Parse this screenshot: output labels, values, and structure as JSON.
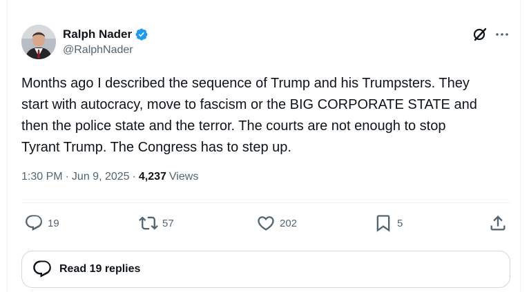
{
  "author": {
    "display_name": "Ralph Nader",
    "handle": "@RalphNader",
    "verified_badge_color": "#1d9bf0"
  },
  "tweet": {
    "text": "Months ago I described the sequence of Trump and his Trumpsters. They\nstart with autocracy, move to fascism or the BIG CORPORATE STATE and\nthen the police state and the terror. The courts are not enough to stop\nTyrant Trump. The Congress has to step up."
  },
  "meta": {
    "time": "1:30 PM",
    "separator": "·",
    "date": "Jun 9, 2025",
    "views_count": "4,237",
    "views_label": "Views"
  },
  "actions": {
    "replies": "19",
    "reposts": "57",
    "likes": "202",
    "bookmarks": "5"
  },
  "read_replies": {
    "label": "Read 19 replies"
  },
  "icons": [
    "verified-icon",
    "grok-icon",
    "more-icon",
    "reply-icon",
    "repost-icon",
    "like-icon",
    "bookmark-icon",
    "share-icon",
    "replies-bubble-icon"
  ],
  "colors": {
    "text_primary": "#0f1419",
    "text_secondary": "#536471",
    "border": "#cfd9de",
    "accent": "#1d9bf0"
  }
}
